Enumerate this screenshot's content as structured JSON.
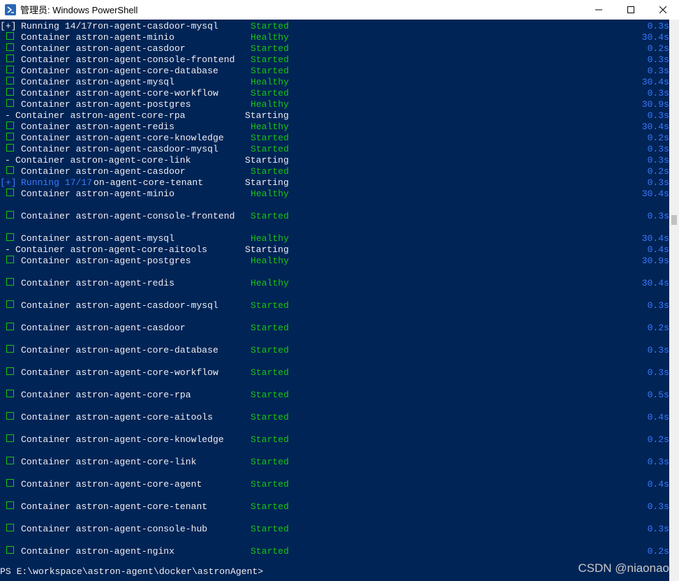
{
  "window": {
    "title": "管理员: Windows PowerShell"
  },
  "lines": [
    {
      "prefix": "[+]",
      "label": "Running 14/17ron-agent-casdoor-mysql",
      "status": "Started",
      "time": "0.3s"
    },
    {
      "prefix": "cb",
      "label": "Container astron-agent-minio",
      "status": "Healthy",
      "time": "30.4s"
    },
    {
      "prefix": "cb",
      "label": "Container astron-agent-casdoor",
      "status": "Started",
      "time": "0.2s"
    },
    {
      "prefix": "cb",
      "label": "Container astron-agent-console-frontend",
      "status": "Started",
      "time": "0.3s"
    },
    {
      "prefix": "cb",
      "label": "Container astron-agent-core-database",
      "status": "Started",
      "time": "0.3s"
    },
    {
      "prefix": "cb",
      "label": "Container astron-agent-mysql",
      "status": "Healthy",
      "time": "30.4s"
    },
    {
      "prefix": "cb",
      "label": "Container astron-agent-core-workflow",
      "status": "Started",
      "time": "0.3s"
    },
    {
      "prefix": "cb",
      "label": "Container astron-agent-postgres",
      "status": "Healthy",
      "time": "30.9s"
    },
    {
      "prefix": "-",
      "label": "Container astron-agent-core-rpa",
      "status": "Starting",
      "time": "0.3s"
    },
    {
      "prefix": "cb",
      "label": "Container astron-agent-redis",
      "status": "Healthy",
      "time": "30.4s"
    },
    {
      "prefix": "cb",
      "label": "Container astron-agent-core-knowledge",
      "status": "Started",
      "time": "0.2s"
    },
    {
      "prefix": "cb",
      "label": "Container astron-agent-casdoor-mysql",
      "status": "Started",
      "time": "0.3s"
    },
    {
      "prefix": "-",
      "label": "Container astron-agent-core-link",
      "status": "Starting",
      "time": "0.3s"
    },
    {
      "prefix": "cb",
      "label": "Container astron-agent-casdoor",
      "status": "Started",
      "time": "0.2s"
    },
    {
      "prefix": "[+]run",
      "label": "on-agent-core-tenant",
      "running": "Running 17/17",
      "status": "Starting",
      "time": "0.3s"
    },
    {
      "prefix": "cb",
      "label": "Container astron-agent-minio",
      "status": "Healthy",
      "time": "30.4s"
    },
    {
      "prefix": "blank"
    },
    {
      "prefix": "cb",
      "label": "Container astron-agent-console-frontend",
      "status": "Started",
      "time": "0.3s"
    },
    {
      "prefix": "blank"
    },
    {
      "prefix": "cb",
      "label": "Container astron-agent-mysql",
      "status": "Healthy",
      "time": "30.4s"
    },
    {
      "prefix": "-",
      "label": "Container astron-agent-core-aitools",
      "status": "Starting",
      "time": "0.4s"
    },
    {
      "prefix": "cb",
      "label": "Container astron-agent-postgres",
      "status": "Healthy",
      "time": "30.9s"
    },
    {
      "prefix": "blank"
    },
    {
      "prefix": "cb",
      "label": "Container astron-agent-redis",
      "status": "Healthy",
      "time": "30.4s"
    },
    {
      "prefix": "blank"
    },
    {
      "prefix": "cb",
      "label": "Container astron-agent-casdoor-mysql",
      "status": "Started",
      "time": "0.3s"
    },
    {
      "prefix": "blank"
    },
    {
      "prefix": "cb",
      "label": "Container astron-agent-casdoor",
      "status": "Started",
      "time": "0.2s"
    },
    {
      "prefix": "blank"
    },
    {
      "prefix": "cb",
      "label": "Container astron-agent-core-database",
      "status": "Started",
      "time": "0.3s"
    },
    {
      "prefix": "blank"
    },
    {
      "prefix": "cb",
      "label": "Container astron-agent-core-workflow",
      "status": "Started",
      "time": "0.3s"
    },
    {
      "prefix": "blank"
    },
    {
      "prefix": "cb",
      "label": "Container astron-agent-core-rpa",
      "status": "Started",
      "time": "0.5s"
    },
    {
      "prefix": "blank"
    },
    {
      "prefix": "cb",
      "label": "Container astron-agent-core-aitools",
      "status": "Started",
      "time": "0.4s"
    },
    {
      "prefix": "blank"
    },
    {
      "prefix": "cb",
      "label": "Container astron-agent-core-knowledge",
      "status": "Started",
      "time": "0.2s"
    },
    {
      "prefix": "blank"
    },
    {
      "prefix": "cb",
      "label": "Container astron-agent-core-link",
      "status": "Started",
      "time": "0.3s"
    },
    {
      "prefix": "blank"
    },
    {
      "prefix": "cb",
      "label": "Container astron-agent-core-agent",
      "status": "Started",
      "time": "0.4s"
    },
    {
      "prefix": "blank"
    },
    {
      "prefix": "cb",
      "label": "Container astron-agent-core-tenant",
      "status": "Started",
      "time": "0.3s"
    },
    {
      "prefix": "blank"
    },
    {
      "prefix": "cb",
      "label": "Container astron-agent-console-hub",
      "status": "Started",
      "time": "0.3s"
    },
    {
      "prefix": "blank"
    },
    {
      "prefix": "cb",
      "label": "Container astron-agent-nginx",
      "status": "Started",
      "time": "0.2s"
    },
    {
      "prefix": "blank"
    }
  ],
  "prompt": "PS E:\\workspace\\astron-agent\\docker\\astronAgent>",
  "watermark": "CSDN @niaonao",
  "colors": {
    "background": "#012456",
    "text": "#eeedf0",
    "status": "#16c60c",
    "time": "#3b78ff"
  }
}
